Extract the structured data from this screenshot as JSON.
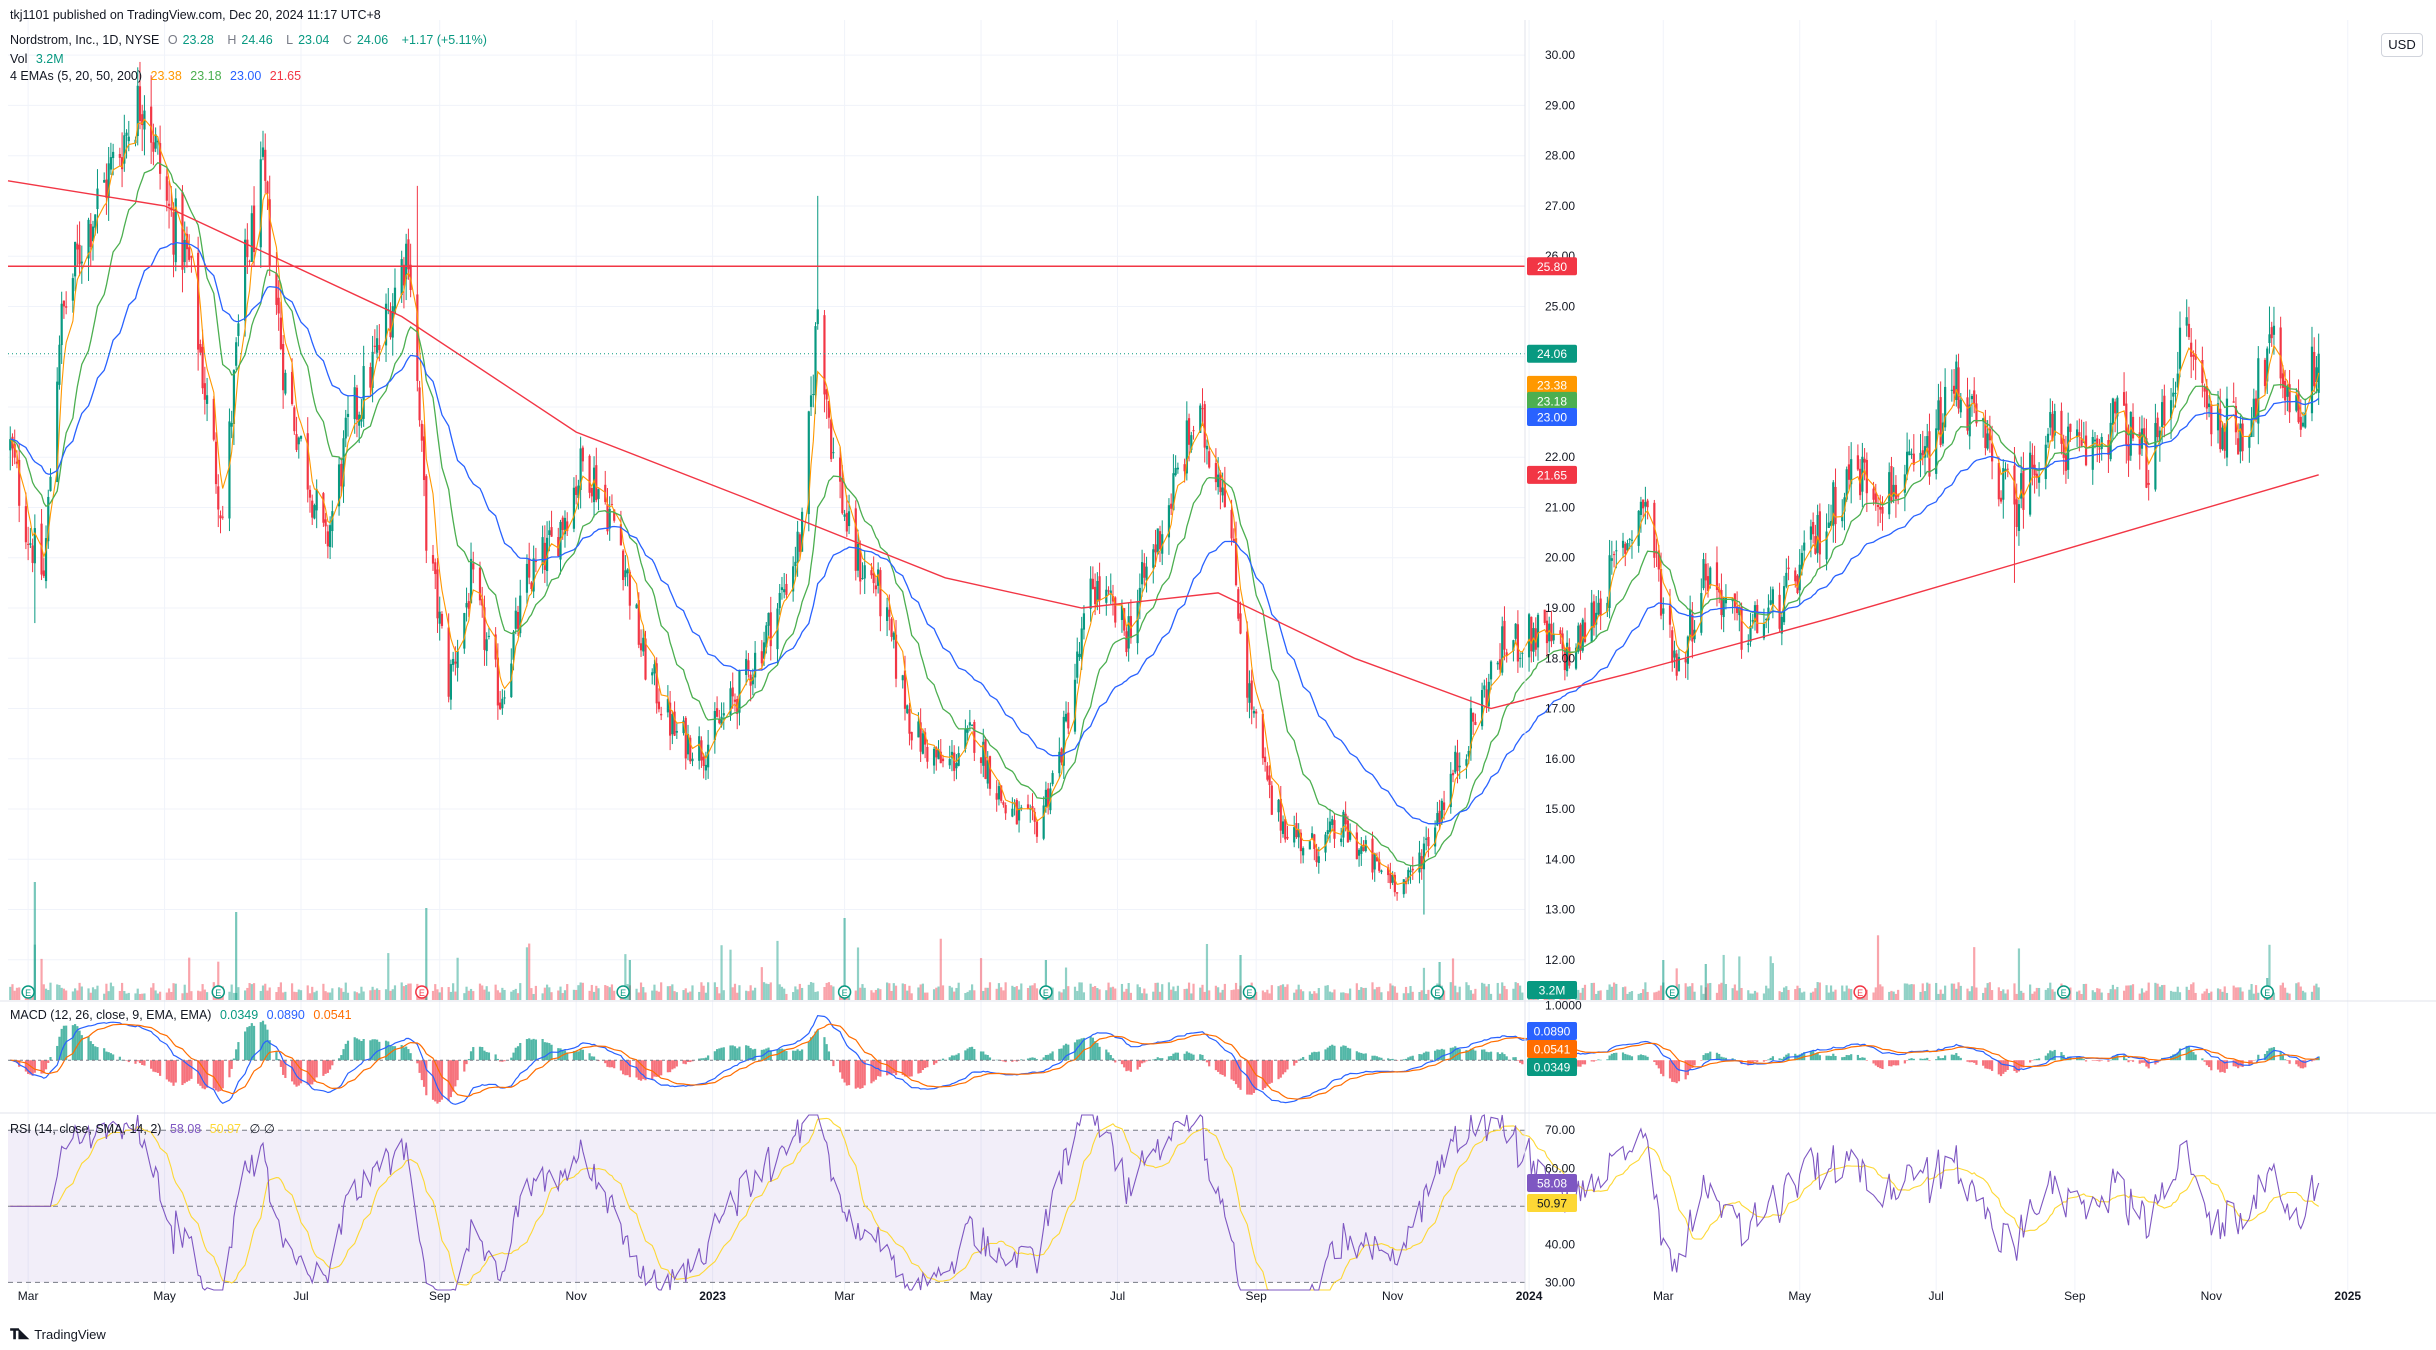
{
  "publisher_line": "tkj1101 published on TradingView.com, Dec 20, 2024 11:17 UTC+8",
  "symbol": {
    "title": "Nordstrom, Inc., 1D, NYSE",
    "open_label": "O",
    "open": "23.28",
    "high_label": "H",
    "high": "24.46",
    "low_label": "L",
    "low": "23.04",
    "close_label": "C",
    "close": "24.06",
    "change": "+1.17 (+5.11%)"
  },
  "volume": {
    "label": "Vol",
    "value": "3.2M"
  },
  "emas": {
    "label": "4 EMAs (5, 20, 50, 200)",
    "values": [
      "23.38",
      "23.18",
      "23.00",
      "21.65"
    ]
  },
  "macd": {
    "label": "MACD (12, 26, close, 9, EMA, EMA)",
    "values": [
      "0.0349",
      "0.0890",
      "0.0541"
    ]
  },
  "rsi": {
    "label": "RSI (14, close, SMA, 14, 2)",
    "values": [
      "58.08",
      "50.97"
    ],
    "extra": "∅ ∅"
  },
  "currency_button": "USD",
  "brand": "TradingView",
  "colors": {
    "up": "#089981",
    "down": "#f23645",
    "ema5": "#ff9800",
    "ema20": "#4caf50",
    "ema50": "#2962ff",
    "ema200": "#f23645",
    "resistance": "#f23645",
    "rsi": "#7e57c2",
    "rsi_ma": "#fdd835"
  },
  "chart_data": [
    {
      "type": "candlestick",
      "title": "Nordstrom, Inc., 1D, NYSE",
      "ylim": [
        11.2,
        30.7
      ],
      "y_ticks": [
        "12.00",
        "13.00",
        "14.00",
        "15.00",
        "16.00",
        "17.00",
        "18.00",
        "19.00",
        "20.00",
        "21.00",
        "22.00",
        "23.00",
        "24.00",
        "25.00",
        "26.00",
        "27.00",
        "28.00",
        "29.00",
        "30.00"
      ],
      "x_ticks": [
        "Mar",
        "May",
        "Jul",
        "Sep",
        "Nov",
        "2023",
        "Mar",
        "May",
        "Jul",
        "Sep",
        "Nov",
        "2024",
        "Mar",
        "May",
        "Jul",
        "Sep",
        "Nov",
        "2025"
      ],
      "price_path": [
        {
          "date": "2022-02-20",
          "close": 22.4
        },
        {
          "date": "2022-03-01",
          "close": 20.5
        },
        {
          "date": "2022-03-08",
          "close": 19.6
        },
        {
          "date": "2022-03-15",
          "close": 24.5
        },
        {
          "date": "2022-03-25",
          "close": 26.3
        },
        {
          "date": "2022-04-05",
          "close": 27.5
        },
        {
          "date": "2022-04-15",
          "close": 28.6
        },
        {
          "date": "2022-04-22",
          "close": 29.3
        },
        {
          "date": "2022-05-02",
          "close": 27.0
        },
        {
          "date": "2022-05-12",
          "close": 25.8
        },
        {
          "date": "2022-05-20",
          "close": 23.0
        },
        {
          "date": "2022-05-27",
          "close": 20.8
        },
        {
          "date": "2022-06-05",
          "close": 25.5
        },
        {
          "date": "2022-06-14",
          "close": 27.5
        },
        {
          "date": "2022-06-24",
          "close": 23.5
        },
        {
          "date": "2022-07-05",
          "close": 21.5
        },
        {
          "date": "2022-07-12",
          "close": 20.2
        },
        {
          "date": "2022-07-22",
          "close": 22.5
        },
        {
          "date": "2022-08-05",
          "close": 24.2
        },
        {
          "date": "2022-08-18",
          "close": 26.3
        },
        {
          "date": "2022-08-26",
          "close": 20.5
        },
        {
          "date": "2022-09-05",
          "close": 17.5
        },
        {
          "date": "2022-09-15",
          "close": 19.5
        },
        {
          "date": "2022-09-28",
          "close": 17.2
        },
        {
          "date": "2022-10-10",
          "close": 19.5
        },
        {
          "date": "2022-10-22",
          "close": 20.3
        },
        {
          "date": "2022-11-05",
          "close": 22.0
        },
        {
          "date": "2022-11-20",
          "close": 20.5
        },
        {
          "date": "2022-12-01",
          "close": 18.0
        },
        {
          "date": "2022-12-15",
          "close": 16.5
        },
        {
          "date": "2022-12-28",
          "close": 16.2
        },
        {
          "date": "2023-01-15",
          "close": 17.5
        },
        {
          "date": "2023-01-30",
          "close": 19.0
        },
        {
          "date": "2023-02-10",
          "close": 20.5
        },
        {
          "date": "2023-02-17",
          "close": 25.0
        },
        {
          "date": "2023-02-24",
          "close": 22.0
        },
        {
          "date": "2023-03-05",
          "close": 20.0
        },
        {
          "date": "2023-03-15",
          "close": 19.5
        },
        {
          "date": "2023-04-01",
          "close": 16.5
        },
        {
          "date": "2023-04-15",
          "close": 15.8
        },
        {
          "date": "2023-04-28",
          "close": 16.5
        },
        {
          "date": "2023-05-12",
          "close": 15.0
        },
        {
          "date": "2023-05-25",
          "close": 14.6
        },
        {
          "date": "2023-06-05",
          "close": 16.0
        },
        {
          "date": "2023-06-20",
          "close": 19.5
        },
        {
          "date": "2023-07-05",
          "close": 18.5
        },
        {
          "date": "2023-07-20",
          "close": 20.5
        },
        {
          "date": "2023-08-05",
          "close": 22.8
        },
        {
          "date": "2023-08-18",
          "close": 21.5
        },
        {
          "date": "2023-08-28",
          "close": 17.5
        },
        {
          "date": "2023-09-08",
          "close": 15.0
        },
        {
          "date": "2023-09-25",
          "close": 14.2
        },
        {
          "date": "2023-10-10",
          "close": 14.6
        },
        {
          "date": "2023-10-25",
          "close": 13.8
        },
        {
          "date": "2023-11-08",
          "close": 13.5
        },
        {
          "date": "2023-11-20",
          "close": 14.8
        },
        {
          "date": "2023-12-05",
          "close": 16.5
        },
        {
          "date": "2023-12-20",
          "close": 18.2
        },
        {
          "date": "2024-01-05",
          "close": 18.5
        },
        {
          "date": "2024-01-20",
          "close": 18.0
        },
        {
          "date": "2024-02-05",
          "close": 19.5
        },
        {
          "date": "2024-02-22",
          "close": 21.2
        },
        {
          "date": "2024-03-01",
          "close": 19.0
        },
        {
          "date": "2024-03-08",
          "close": 17.8
        },
        {
          "date": "2024-03-20",
          "close": 19.8
        },
        {
          "date": "2024-04-05",
          "close": 18.5
        },
        {
          "date": "2024-04-22",
          "close": 19.0
        },
        {
          "date": "2024-05-10",
          "close": 20.5
        },
        {
          "date": "2024-05-25",
          "close": 21.8
        },
        {
          "date": "2024-06-08",
          "close": 21.3
        },
        {
          "date": "2024-06-25",
          "close": 21.8
        },
        {
          "date": "2024-07-10",
          "close": 23.5
        },
        {
          "date": "2024-07-25",
          "close": 22.0
        },
        {
          "date": "2024-08-05",
          "close": 21.0
        },
        {
          "date": "2024-08-20",
          "close": 22.5
        },
        {
          "date": "2024-09-05",
          "close": 22.0
        },
        {
          "date": "2024-09-20",
          "close": 22.8
        },
        {
          "date": "2024-10-05",
          "close": 21.8
        },
        {
          "date": "2024-10-20",
          "close": 24.5
        },
        {
          "date": "2024-11-01",
          "close": 22.8
        },
        {
          "date": "2024-11-15",
          "close": 22.5
        },
        {
          "date": "2024-11-28",
          "close": 24.2
        },
        {
          "date": "2024-12-10",
          "close": 22.8
        },
        {
          "date": "2024-12-19",
          "close": 24.06
        }
      ],
      "ema200_path": [
        {
          "date": "2022-02-20",
          "value": 27.5
        },
        {
          "date": "2022-05-01",
          "value": 27.0
        },
        {
          "date": "2022-08-15",
          "value": 24.8
        },
        {
          "date": "2022-11-01",
          "value": 22.5
        },
        {
          "date": "2023-01-15",
          "value": 21.2
        },
        {
          "date": "2023-04-15",
          "value": 19.6
        },
        {
          "date": "2023-06-15",
          "value": 19.0
        },
        {
          "date": "2023-08-15",
          "value": 19.3
        },
        {
          "date": "2023-10-15",
          "value": 18.0
        },
        {
          "date": "2023-12-15",
          "value": 17.0
        },
        {
          "date": "2024-02-15",
          "value": 17.7
        },
        {
          "date": "2024-05-15",
          "value": 18.8
        },
        {
          "date": "2024-08-15",
          "value": 20.0
        },
        {
          "date": "2024-10-15",
          "value": 20.8
        },
        {
          "date": "2024-12-19",
          "value": 21.65
        }
      ],
      "last_ema_values": {
        "ema5": 23.38,
        "ema20": 23.18,
        "ema50": 23.0,
        "ema200": 21.65
      },
      "resistance_line": 25.8,
      "last_price": 24.06,
      "axis_labels": [
        "25.80",
        "24.06",
        "23.38",
        "23.18",
        "23.00",
        "21.65",
        "3.2M"
      ]
    },
    {
      "type": "histogram",
      "title": "MACD (12, 26, close, 9, EMA, EMA)",
      "ylim": [
        -0.95,
        1.05
      ],
      "y_ticks": [
        "1.0000"
      ],
      "last_values": {
        "histogram": 0.0349,
        "macd": 0.089,
        "signal": 0.0541
      },
      "axis_labels": [
        "0.0890",
        "0.0541",
        "0.0349"
      ]
    },
    {
      "type": "line",
      "title": "RSI (14, close, SMA, 14, 2)",
      "ylim": [
        28,
        74
      ],
      "y_ticks": [
        "70.00",
        "60.00",
        "40.00",
        "30.00"
      ],
      "bands": [
        30,
        50,
        70
      ],
      "last_values": {
        "rsi": 58.08,
        "rsi_ma": 50.97
      },
      "axis_labels": [
        "58.08",
        "50.97"
      ]
    }
  ]
}
